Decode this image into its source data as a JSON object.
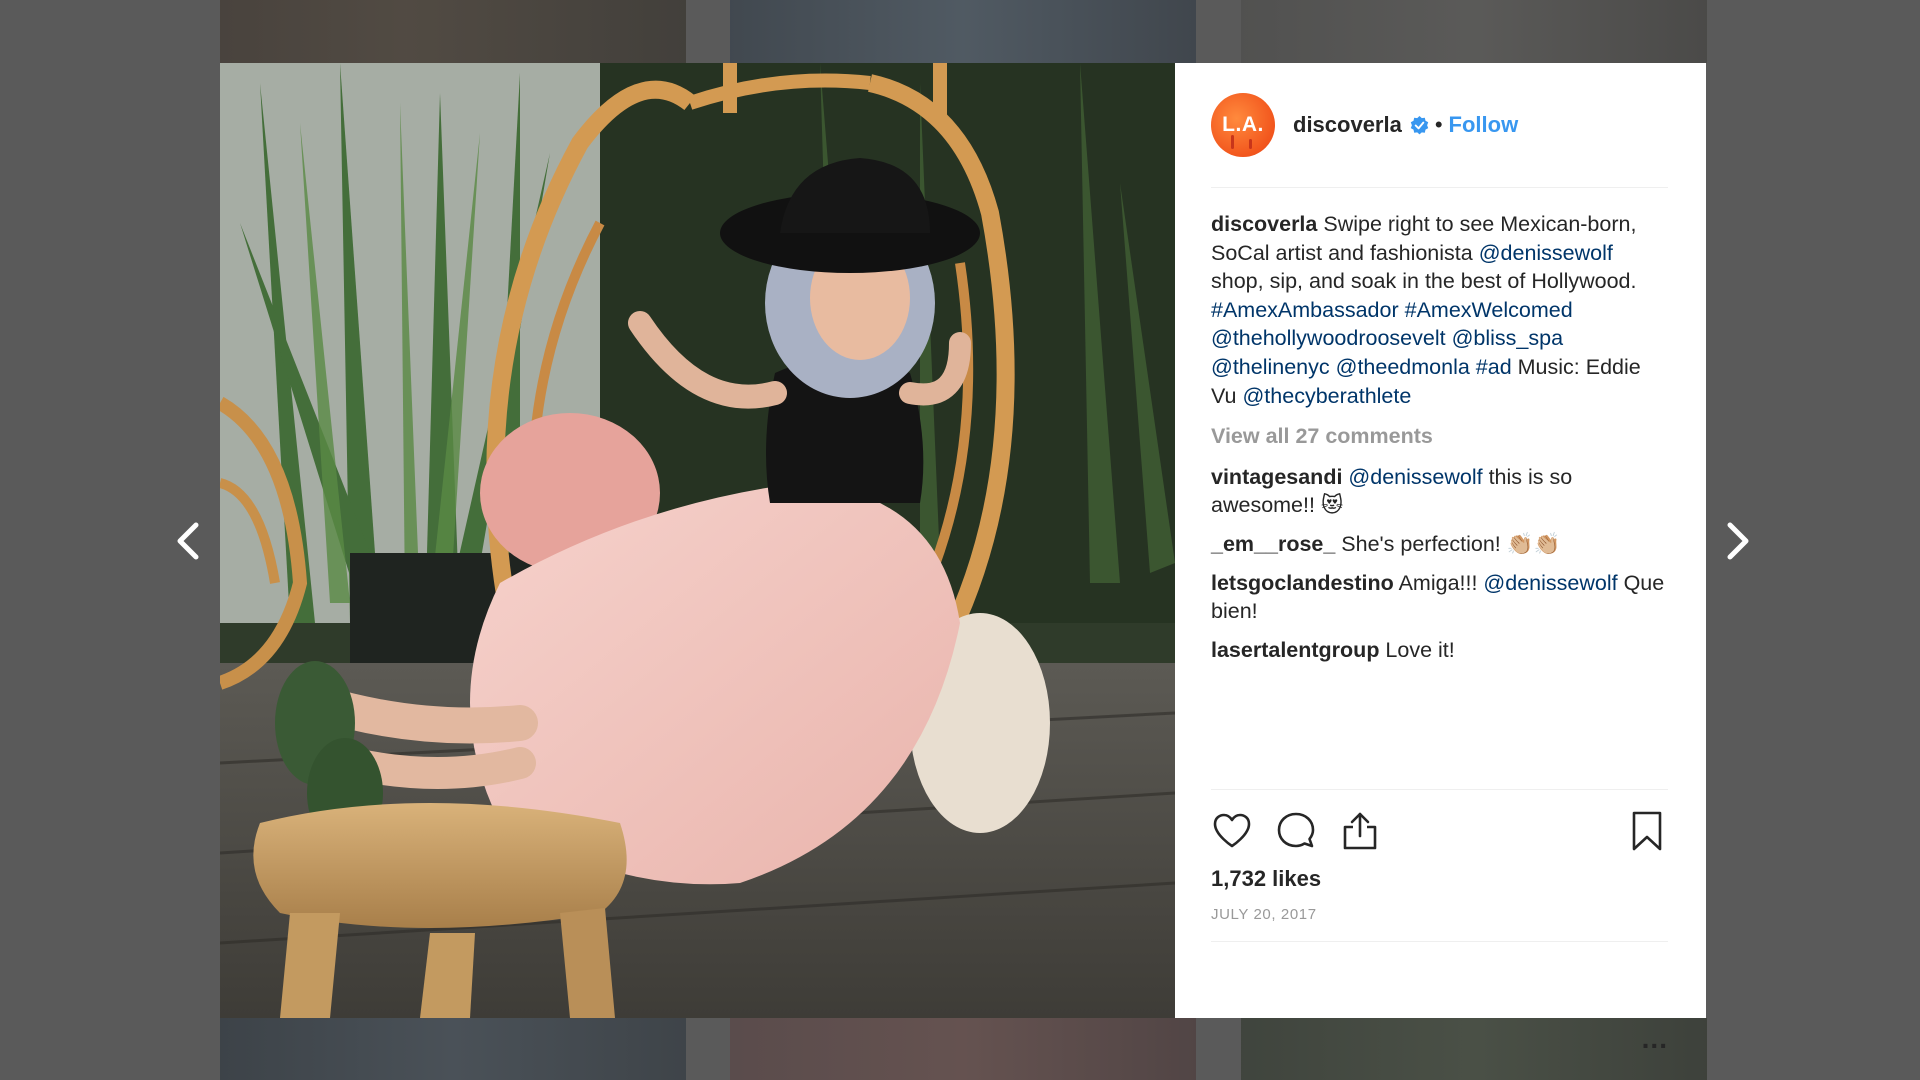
{
  "post": {
    "author": "discoverla",
    "avatar_text": "L.A.",
    "follow_label": "Follow",
    "separator": "•",
    "caption": {
      "segments": [
        {
          "type": "user",
          "text": "discoverla"
        },
        {
          "type": "text",
          "text": " Swipe right to see Mexican-born, SoCal artist and fashionista "
        },
        {
          "type": "tag",
          "text": "@denissewolf"
        },
        {
          "type": "text",
          "text": " shop, sip, and soak in the best of Hollywood. "
        },
        {
          "type": "tag",
          "text": "#AmexAmbassador"
        },
        {
          "type": "text",
          "text": " "
        },
        {
          "type": "tag",
          "text": "#AmexWelcomed"
        },
        {
          "type": "text",
          "text": " "
        },
        {
          "type": "tag",
          "text": "@thehollywoodroosevelt"
        },
        {
          "type": "text",
          "text": " "
        },
        {
          "type": "tag",
          "text": "@bliss_spa"
        },
        {
          "type": "text",
          "text": " "
        },
        {
          "type": "tag",
          "text": "@thelinenyc"
        },
        {
          "type": "text",
          "text": " "
        },
        {
          "type": "tag",
          "text": "@theedmonla"
        },
        {
          "type": "text",
          "text": " "
        },
        {
          "type": "tag",
          "text": "#ad"
        },
        {
          "type": "text",
          "text": " Music: Eddie Vu "
        },
        {
          "type": "tag",
          "text": "@thecyberathlete"
        }
      ]
    },
    "view_all_comments": "View all 27 comments",
    "comments": [
      {
        "user": "vintagesandi",
        "segments": [
          {
            "type": "text",
            "text": " "
          },
          {
            "type": "tag",
            "text": "@denissewolf"
          },
          {
            "type": "text",
            "text": " this is so awesome!! 😻"
          }
        ]
      },
      {
        "user": "_em__rose_",
        "segments": [
          {
            "type": "text",
            "text": " She's perfection! 👏🏼👏🏼"
          }
        ]
      },
      {
        "user": "letsgoclandestino",
        "segments": [
          {
            "type": "text",
            "text": " Amiga!!! "
          },
          {
            "type": "tag",
            "text": "@denissewolf"
          },
          {
            "type": "text",
            "text": " Que bien!"
          }
        ]
      },
      {
        "user": "lasertalentgroup",
        "segments": [
          {
            "type": "text",
            "text": " Love it!"
          }
        ]
      }
    ],
    "likes": "1,732 likes",
    "date": "JULY 20, 2017",
    "more_label": "..."
  },
  "icons": {
    "prev": "chevron-left-icon",
    "next": "chevron-right-icon",
    "like": "heart-icon",
    "comment": "speech-bubble-icon",
    "share": "share-upload-icon",
    "save": "bookmark-icon",
    "verified": "verified-badge-icon"
  },
  "colors": {
    "link": "#003569",
    "follow": "#3897f0",
    "verified": "#3897f0",
    "avatar": "#f2561d",
    "muted": "#999999",
    "text": "#262626"
  }
}
